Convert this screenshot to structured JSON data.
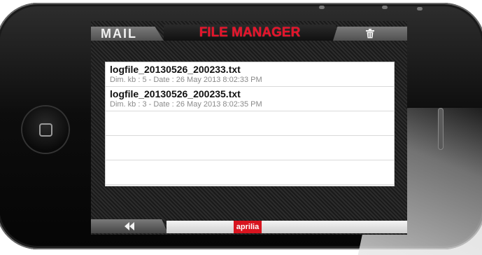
{
  "header": {
    "mail_tab": "MAIL",
    "file_manager_tab": "FILE MANAGER",
    "trash_icon": "trash-icon"
  },
  "files": [
    {
      "name": "logfile_20130526_200233.txt",
      "meta": "Dim. kb : 5 - Date : 26 May 2013 8:02:33 PM"
    },
    {
      "name": "logfile_20130526_200235.txt",
      "meta": "Dim. kb : 3 - Date : 26 May 2013 8:02:35 PM"
    }
  ],
  "footer": {
    "back_icon": "back-icon",
    "brand_label": "aprilia"
  },
  "colors": {
    "accent_red": "#e4132a",
    "brand_red": "#d8141f"
  }
}
